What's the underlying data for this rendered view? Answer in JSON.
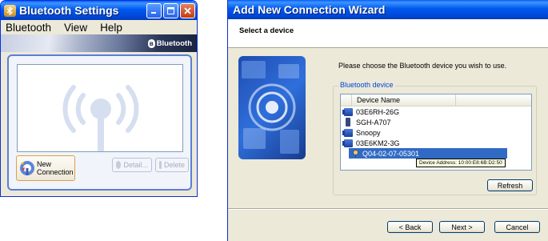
{
  "settings_window": {
    "title": "Bluetooth Settings",
    "menu": [
      "Bluetooth",
      "View",
      "Help"
    ],
    "banner_brand": "Bluetooth",
    "new_connection_label": "New Connection",
    "detail_label": "Detail...",
    "delete_label": "Delete",
    "icons": [
      "bluetooth-app-icon",
      "minimize-icon",
      "maximize-icon",
      "close-icon",
      "bluetooth-signal-icon",
      "new-connection-icon"
    ]
  },
  "wizard": {
    "title": "Add New Connection Wizard",
    "step_title": "Select a device",
    "instruction": "Please choose the Bluetooth device you wish to use.",
    "group_label": "Bluetooth device",
    "column_header": "Device Name",
    "devices": [
      {
        "name": "03E6RH-26G",
        "icon": "computer-icon",
        "selected": false
      },
      {
        "name": "SGH-A707",
        "icon": "phone-icon",
        "selected": false
      },
      {
        "name": "Snoopy",
        "icon": "computer-icon",
        "selected": false
      },
      {
        "name": "03E6KM2-3G",
        "icon": "computer-icon",
        "selected": false
      },
      {
        "name": "Q04-02-07-05301",
        "icon": "pin-icon",
        "selected": true
      }
    ],
    "tooltip": "Device Address: 10:00:E8:6B:D2:50",
    "refresh_label": "Refresh",
    "back_label": "< Back",
    "next_label": "Next >",
    "cancel_label": "Cancel"
  },
  "colors": {
    "titlebar": "#0054e3",
    "selection": "#316ac5",
    "group_label": "#0046d5",
    "dialog_bg": "#ece9d8"
  }
}
